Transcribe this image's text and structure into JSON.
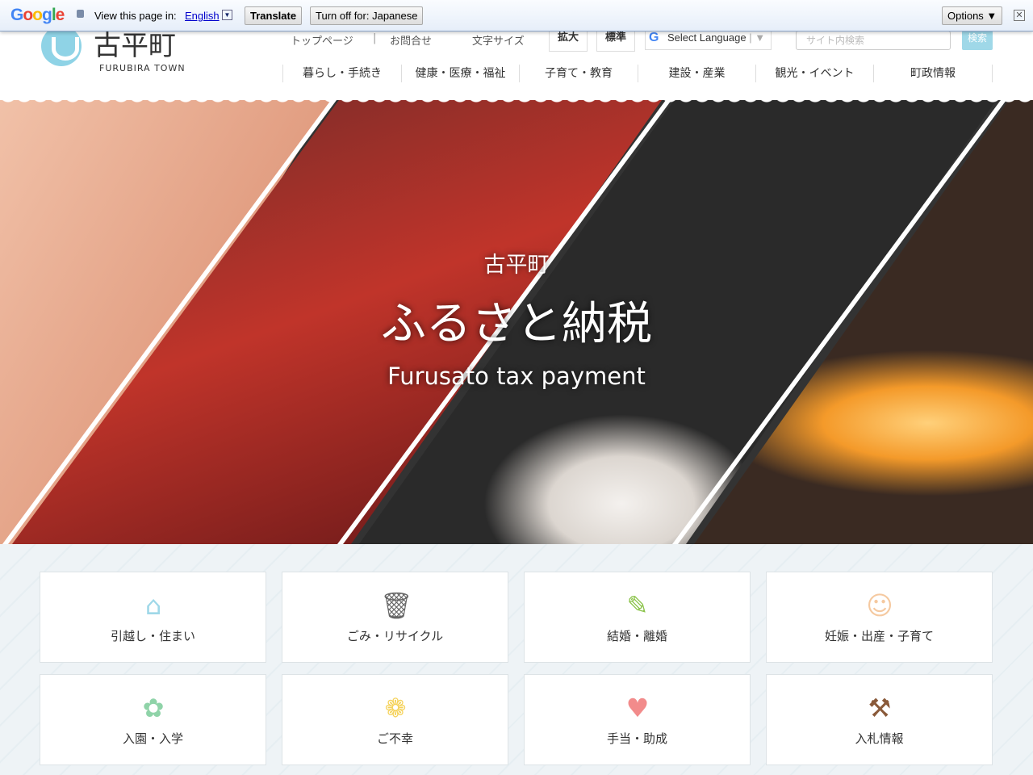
{
  "translate_bar": {
    "brand": "Google",
    "view_label": "View this page in:",
    "language": "English",
    "translate_button": "Translate",
    "turn_off_button": "Turn off for: Japanese",
    "options_button": "Options ▼",
    "close": "✕"
  },
  "header": {
    "logo_jp": "古平町",
    "logo_en": "FURUBIRA TOWN",
    "util": {
      "top": "トップページ",
      "contact": "お問合せ",
      "font_size": "文字サイズ",
      "enlarge": "拡大",
      "standard": "標準"
    },
    "select_language": "Select Language",
    "search_placeholder": "サイト内検索",
    "search_button": "検索"
  },
  "nav": [
    "暮らし・手続き",
    "健康・医療・福祉",
    "子育て・教育",
    "建設・産業",
    "観光・イベント",
    "町政情報"
  ],
  "hero": {
    "town": "古平町",
    "title": "ふるさと納税",
    "subtitle": "Furusato tax payment"
  },
  "cards": [
    {
      "label": "引越し・住まい",
      "icon": "house-icon",
      "color": "#9fd8e8"
    },
    {
      "label": "ごみ・リサイクル",
      "icon": "trash-icon",
      "color": "#666666"
    },
    {
      "label": "結婚・離婚",
      "icon": "document-pen-icon",
      "color": "#8bc34a"
    },
    {
      "label": "妊娠・出産・子育て",
      "icon": "baby-icon",
      "color": "#f5c9a0"
    },
    {
      "label": "入園・入学",
      "icon": "sakura-icon",
      "color": "#8fd3a8"
    },
    {
      "label": "ご不幸",
      "icon": "chrysanthemum-icon",
      "color": "#f5d25a"
    },
    {
      "label": "手当・助成",
      "icon": "heart-hand-icon",
      "color": "#f28b8b"
    },
    {
      "label": "入札情報",
      "icon": "gavel-icon",
      "color": "#8a5a3a"
    }
  ]
}
